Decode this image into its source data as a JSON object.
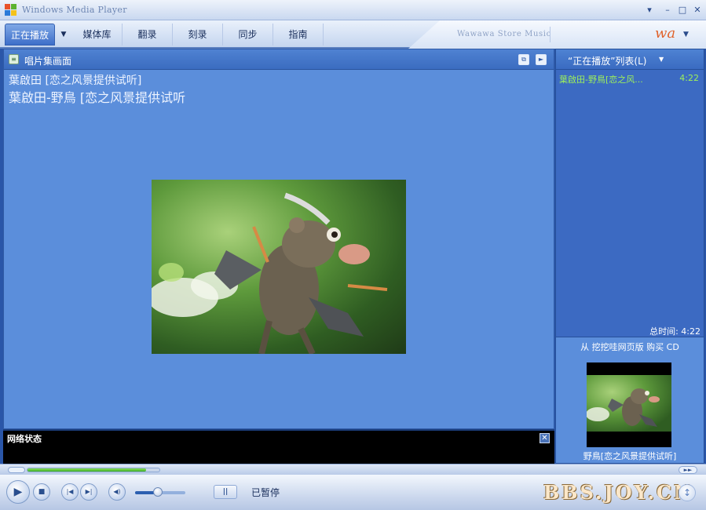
{
  "window": {
    "title": "Windows Media Player",
    "controls": {
      "minimize": "–",
      "restore": "▫",
      "maximize": "□",
      "close": "✕",
      "menu": "▾"
    }
  },
  "tabs": [
    {
      "label": "正在播放",
      "active": true
    },
    {
      "label": "媒体库"
    },
    {
      "label": "翻录"
    },
    {
      "label": "刻录"
    },
    {
      "label": "同步"
    },
    {
      "label": "指南"
    }
  ],
  "tab_dropdown": "▼",
  "store": {
    "label": "Wawawa Store Music",
    "logo_text": "wa",
    "chevron": "▼"
  },
  "visualization": {
    "label": "唱片集画面",
    "icon_glyph": "≡",
    "btn1_glyph": "⧉",
    "btn2_glyph": "►"
  },
  "now_playing": {
    "line1": "葉啟田 [恋之风景提供试听]",
    "line2": "葉啟田-野鳥 [恋之风景提供试听"
  },
  "network": {
    "label": "网络状态",
    "close": "✕"
  },
  "playlist": {
    "title": "“正在播放”列表(L)",
    "chevron": "▼",
    "items": [
      {
        "title": "葉啟田-野鳥[恋之风...",
        "duration": "4:22"
      }
    ],
    "total": "总时间: 4:22",
    "buy_link": "从 挖挖哇网页版 购买 CD",
    "caption": "野鳥[恋之风景提供试听]"
  },
  "seek": {
    "progress": 0.9,
    "right_glyph": "►►"
  },
  "controls": {
    "play": "▶",
    "stop": "■",
    "prev": "|◀",
    "next": "▶|",
    "mute": "◀)",
    "pause": "||",
    "volume": 0.45,
    "status": "已暂停",
    "right_btn": "↕"
  },
  "watermark": "BBS.JOY.CN"
}
